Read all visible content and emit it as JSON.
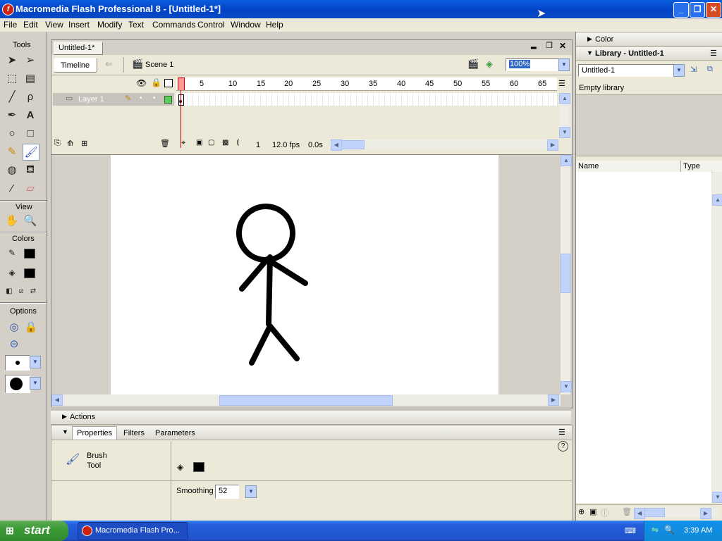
{
  "window": {
    "title": "Macromedia Flash Professional 8 - [Untitled-1*]",
    "logo_letter": "f"
  },
  "menu": [
    "File",
    "Edit",
    "View",
    "Insert",
    "Modify",
    "Text",
    "Commands",
    "Control",
    "Window",
    "Help"
  ],
  "tools_panel": {
    "title": "Tools",
    "view_label": "View",
    "colors_label": "Colors",
    "options_label": "Options"
  },
  "document": {
    "tab": "Untitled-1*",
    "timeline_button": "Timeline",
    "scene": "Scene 1",
    "zoom": "100%"
  },
  "timeline": {
    "layer_name": "Layer 1",
    "frame_numbers": [
      "1",
      "5",
      "10",
      "15",
      "20",
      "25",
      "30",
      "35",
      "40",
      "45",
      "50",
      "55",
      "60",
      "65"
    ],
    "current_frame": "1",
    "fps": "12.0 fps",
    "elapsed": "0.0s"
  },
  "bottom_panels": {
    "actions_label": "Actions",
    "tabs": [
      "Properties",
      "Filters",
      "Parameters"
    ],
    "tool_name_line1": "Brush",
    "tool_name_line2": "Tool",
    "smoothing_label": "Smoothing",
    "smoothing_value": "52",
    "help_icon": "?"
  },
  "right_panels": {
    "color_label": "Color",
    "library_title": "Library - Untitled-1",
    "library_select": "Untitled-1",
    "empty_text": "Empty library",
    "col_name": "Name",
    "col_type": "Type"
  },
  "taskbar": {
    "start": "start",
    "task_item": "Macromedia Flash Pro...",
    "clock": "3:39 AM"
  },
  "colors": {
    "stroke": "#000000",
    "fill": "#000000",
    "stage_bg": "#ffffff",
    "workarea_bg": "#d4d0c8",
    "layer_active": "#c5c3bc"
  }
}
